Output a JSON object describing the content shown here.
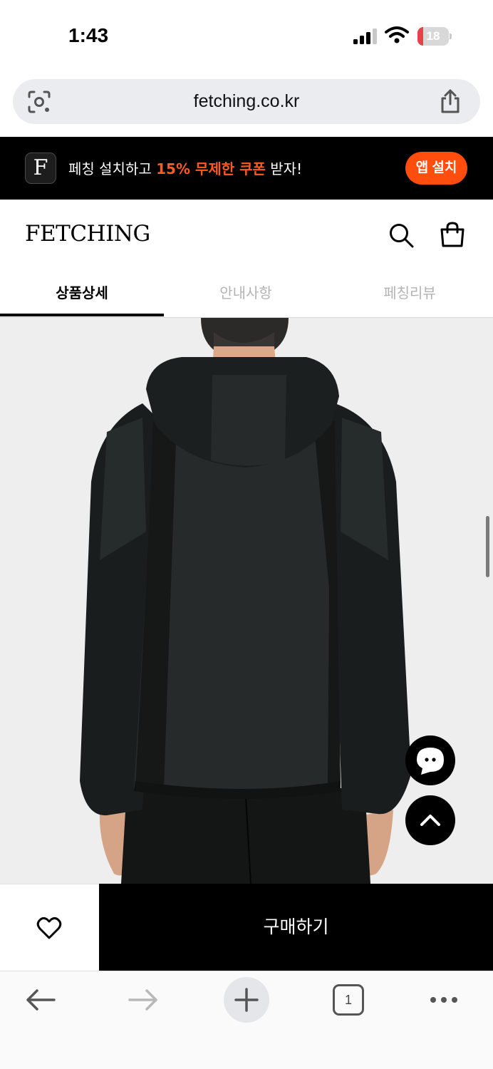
{
  "status_bar": {
    "time": "1:43",
    "battery": "18",
    "battery_level": 0.18
  },
  "address_bar": {
    "url": "fetching.co.kr"
  },
  "promo_banner": {
    "logo_letter": "F",
    "text_before": "페칭 설치하고 ",
    "highlight": "15% 무제한 쿠폰",
    "text_after": " 받자!",
    "install_label": "앱 설치"
  },
  "header": {
    "logo": "FETCHING"
  },
  "tabs": [
    {
      "label": "상품상세",
      "active": true
    },
    {
      "label": "안내사항",
      "active": false
    },
    {
      "label": "페칭리뷰",
      "active": false
    }
  ],
  "purchase_bar": {
    "buy_label": "구매하기"
  },
  "browser_toolbar": {
    "tab_count": "1"
  },
  "colors": {
    "accent": "#ff4d0d",
    "black": "#000000",
    "inactive_tab": "#b3b3b3"
  },
  "icons": [
    "lens-icon",
    "share-icon",
    "search-icon",
    "bag-icon",
    "chat-icon",
    "chevron-up-icon",
    "heart-icon",
    "back-arrow-icon",
    "forward-arrow-icon",
    "plus-icon",
    "more-icon"
  ]
}
